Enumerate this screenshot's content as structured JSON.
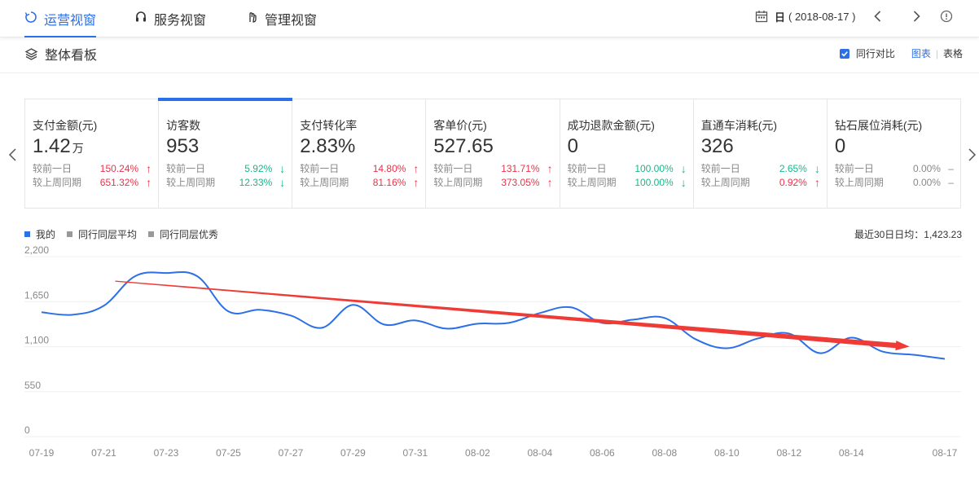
{
  "nav": {
    "tabs": [
      {
        "label": "运营视窗",
        "icon": "refresh-circle-icon",
        "active": true
      },
      {
        "label": "服务视窗",
        "icon": "headset-icon",
        "active": false
      },
      {
        "label": "管理视窗",
        "icon": "hand-icon",
        "active": false
      }
    ],
    "period_label": "日",
    "date_label": "( 2018-08-17 )"
  },
  "subheader": {
    "title": "整体看板",
    "compare_label": "同行对比",
    "compare_checked": true,
    "view_chart": "图表",
    "view_table": "表格"
  },
  "metrics": [
    {
      "label": "支付金额(元)",
      "value": "1.42",
      "unit": "万",
      "d1_label": "较前一日",
      "d1": "150.24%",
      "d1_dir": "up",
      "w1_label": "较上周同期",
      "w1": "651.32%",
      "w1_dir": "up"
    },
    {
      "label": "访客数",
      "value": "953",
      "unit": "",
      "d1_label": "较前一日",
      "d1": "5.92%",
      "d1_dir": "down",
      "w1_label": "较上周同期",
      "w1": "12.33%",
      "w1_dir": "down"
    },
    {
      "label": "支付转化率",
      "value": "2.83%",
      "unit": "",
      "d1_label": "较前一日",
      "d1": "14.80%",
      "d1_dir": "up",
      "w1_label": "较上周同期",
      "w1": "81.16%",
      "w1_dir": "up"
    },
    {
      "label": "客单价(元)",
      "value": "527.65",
      "unit": "",
      "d1_label": "较前一日",
      "d1": "131.71%",
      "d1_dir": "up",
      "w1_label": "较上周同期",
      "w1": "373.05%",
      "w1_dir": "up"
    },
    {
      "label": "成功退款金额(元)",
      "value": "0",
      "unit": "",
      "d1_label": "较前一日",
      "d1": "100.00%",
      "d1_dir": "down",
      "w1_label": "较上周同期",
      "w1": "100.00%",
      "w1_dir": "down"
    },
    {
      "label": "直通车消耗(元)",
      "value": "326",
      "unit": "",
      "d1_label": "较前一日",
      "d1": "2.65%",
      "d1_dir": "down",
      "w1_label": "较上周同期",
      "w1": "0.92%",
      "w1_dir": "up"
    },
    {
      "label": "钻石展位消耗(元)",
      "value": "0",
      "unit": "",
      "d1_label": "较前一日",
      "d1": "0.00%",
      "d1_dir": "flat",
      "w1_label": "较上周同期",
      "w1": "0.00%",
      "w1_dir": "flat"
    }
  ],
  "selected_metric_index": 1,
  "colors": {
    "accent": "#2c6fe6",
    "up": "#e8334a",
    "down": "#16b88a",
    "trend_arrow": "#ef3b36",
    "legend_gray": "#999999"
  },
  "chart_data": {
    "type": "line",
    "legend": [
      {
        "name": "我的",
        "color": "#2c6fe6"
      },
      {
        "name": "同行同层平均",
        "color": "#999999"
      },
      {
        "name": "同行同层优秀",
        "color": "#999999"
      }
    ],
    "summary": "最近30日日均：1,423.23",
    "x": [
      "07-19",
      "07-20",
      "07-21",
      "07-22",
      "07-23",
      "07-24",
      "07-25",
      "07-26",
      "07-27",
      "07-28",
      "07-29",
      "07-30",
      "07-31",
      "08-01",
      "08-02",
      "08-03",
      "08-04",
      "08-05",
      "08-06",
      "08-07",
      "08-08",
      "08-09",
      "08-10",
      "08-11",
      "08-12",
      "08-13",
      "08-14",
      "08-15",
      "08-16",
      "08-17"
    ],
    "x_tick_labels": [
      "07-19",
      "07-21",
      "07-23",
      "07-25",
      "07-27",
      "07-29",
      "07-31",
      "08-02",
      "08-04",
      "08-06",
      "08-08",
      "08-10",
      "08-12",
      "08-14",
      "08-17"
    ],
    "y_ticks": [
      "2,200",
      "1,650",
      "1,100",
      "550",
      "0"
    ],
    "ylim": [
      0,
      2200
    ],
    "series": [
      {
        "name": "我的",
        "values": [
          1520,
          1490,
          1600,
          1960,
          2000,
          1960,
          1530,
          1550,
          1480,
          1330,
          1610,
          1370,
          1420,
          1320,
          1380,
          1390,
          1510,
          1580,
          1390,
          1430,
          1450,
          1190,
          1080,
          1200,
          1260,
          1020,
          1210,
          1040,
          1000,
          950
        ]
      }
    ],
    "trend_arrow": {
      "from": {
        "x": "07-21",
        "y": 1900
      },
      "to": {
        "x": "08-16",
        "y": 1100
      }
    }
  }
}
